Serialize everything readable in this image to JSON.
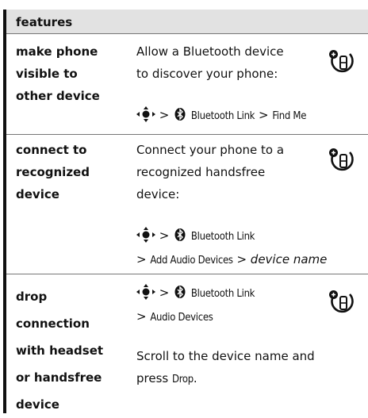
{
  "header": {
    "title": "features"
  },
  "rows": [
    {
      "feature_lines": [
        "make phone",
        "visible to",
        "other device"
      ],
      "desc_lines": [
        "Allow a Bluetooth device",
        "to discover your phone:"
      ],
      "path": {
        "gt1": ">",
        "menu1": "Bluetooth Link",
        "gt2": ">",
        "menu2": "Find Me"
      }
    },
    {
      "feature_lines": [
        "connect to",
        "recognized",
        "device"
      ],
      "desc_lines": [
        "Connect your phone to a",
        "recognized handsfree",
        "device:"
      ],
      "path": {
        "gt1": ">",
        "menu1": "Bluetooth Link",
        "gt2": ">",
        "menu2": "Add Audio Devices",
        "gt3": ">",
        "italic": "device name"
      }
    },
    {
      "feature_lines": [
        "drop",
        "connection",
        "with headset",
        "or handsfree",
        "device"
      ],
      "path": {
        "gt1": ">",
        "menu1": "Bluetooth Link",
        "gt2": ">",
        "menu2": "Audio Devices"
      },
      "desc_lines": [
        "Scroll to the device name and",
        "press"
      ],
      "drop_word": "Drop",
      "period": "."
    }
  ],
  "icons": {
    "nav": "nav-key-icon",
    "bluetooth": "bluetooth-icon",
    "handsfree": "handsfree-phone-icon"
  }
}
